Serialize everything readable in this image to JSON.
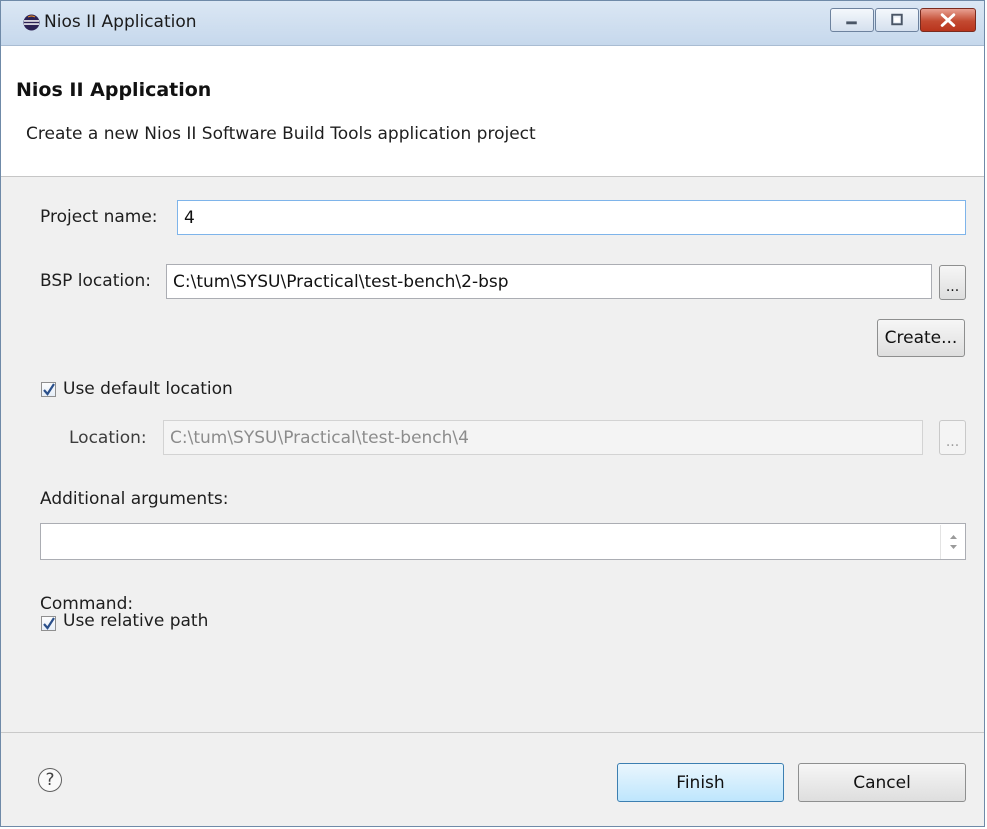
{
  "window": {
    "title": "Nios II Application",
    "controls": [
      "minimize-icon",
      "maximize-icon",
      "close-icon"
    ]
  },
  "banner": {
    "title": "Nios II Application",
    "description": "Create a new Nios II Software Build Tools application project"
  },
  "form": {
    "project_name_label": "Project name:",
    "project_name_value": "4",
    "bsp_location_label": "BSP location:",
    "bsp_location_value": "C:\\tum\\SYSU\\Practical\\test-bench\\2-bsp",
    "browse_label": "...",
    "create_label": "Create...",
    "use_default_location_label": "Use default location",
    "use_default_location_checked": true,
    "location_label": "Location:",
    "location_value": "C:\\tum\\SYSU\\Practical\\test-bench\\4",
    "location_browse_label": "...",
    "additional_arguments_label": "Additional arguments:",
    "additional_arguments_value": "",
    "command_label": "Command:",
    "use_relative_path_label": "Use relative path",
    "use_relative_path_checked": true
  },
  "footer": {
    "help_icon": "help-icon",
    "help_glyph": "?",
    "finish_label": "Finish",
    "cancel_label": "Cancel"
  }
}
